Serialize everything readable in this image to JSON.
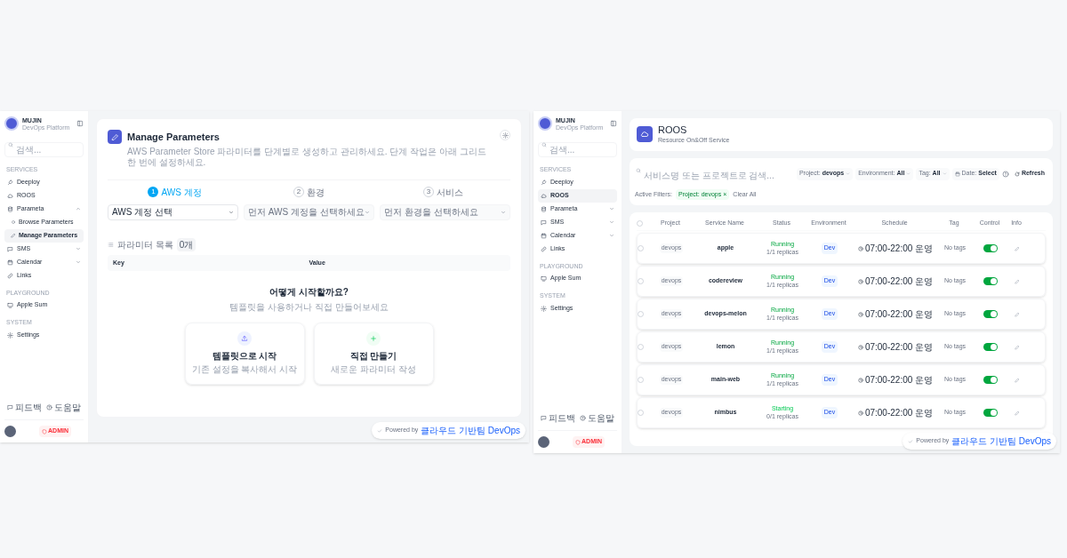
{
  "screens": [
    {
      "sidebar": {
        "brand": "MUJIN",
        "tagline": "DevOps Platform",
        "search": {
          "placeholder": "검색..."
        },
        "sections": [
          {
            "heading": "SERVICES",
            "items": [
              {
                "label": "Deeploy",
                "selected": false
              },
              {
                "label": "ROOS",
                "selected": false
              },
              {
                "label": "Parameta",
                "selected": false,
                "expanded": true,
                "children": [
                  {
                    "label": "Browse Parameters",
                    "selected": false
                  },
                  {
                    "label": "Manage Parameters",
                    "selected": true
                  }
                ]
              },
              {
                "label": "SMS",
                "selected": false,
                "expanded": false
              },
              {
                "label": "Calendar",
                "selected": false,
                "expanded": false
              },
              {
                "label": "Links",
                "selected": false
              }
            ]
          },
          {
            "heading": "PLAYGROUND",
            "items": [
              {
                "label": "Apple Sum",
                "selected": false
              }
            ]
          },
          {
            "heading": "SYSTEM",
            "items": [
              {
                "label": "Settings",
                "selected": false
              }
            ]
          }
        ],
        "footer_links": [
          "피드백",
          "도움말"
        ],
        "role": "ADMIN"
      },
      "page": {
        "kind": "parameters",
        "title": "Manage Parameters",
        "subtitle": "AWS Parameter Store 파라미터를 단계별로 생성하고 관리하세요. 단계 작업은 아래 그리드 한 번에 설정하세요.",
        "steps": [
          {
            "number": "1",
            "label": "AWS 계정",
            "selected": true
          },
          {
            "number": "2",
            "label": "환경",
            "selected": false
          },
          {
            "number": "3",
            "label": "서비스",
            "selected": false
          }
        ],
        "selects": [
          {
            "value": "AWS 계정 선택",
            "disabled": false
          },
          {
            "value": "먼저 AWS 계정을 선택하세요",
            "disabled": true
          },
          {
            "value": "먼저 환경을 선택하세요",
            "disabled": true
          }
        ],
        "list": {
          "title": "파라미터 목록",
          "count": "0개",
          "columns": [
            "Key",
            "Value"
          ]
        },
        "empty": {
          "title": "어떻게 시작할까요?",
          "subtitle": "템플릿을 사용하거나 직접 만들어보세요",
          "options": [
            {
              "title": "템플릿으로 시작",
              "subtitle": "기존 설정을 복사해서 시작"
            },
            {
              "title": "직접 만들기",
              "subtitle": "새로운 파라미터 작성"
            }
          ]
        },
        "footer": {
          "prefix": "Powered by",
          "team": "클라우드 기반팀 DevOps"
        }
      }
    },
    {
      "sidebar": {
        "brand": "MUJIN",
        "tagline": "DevOps Platform",
        "search": {
          "placeholder": "검색..."
        },
        "sections": [
          {
            "heading": "SERVICES",
            "items": [
              {
                "label": "Deeploy",
                "selected": false
              },
              {
                "label": "ROOS",
                "selected": true
              },
              {
                "label": "Parameta",
                "selected": false,
                "expanded": false
              },
              {
                "label": "SMS",
                "selected": false,
                "expanded": false
              },
              {
                "label": "Calendar",
                "selected": false,
                "expanded": false
              },
              {
                "label": "Links",
                "selected": false
              }
            ]
          },
          {
            "heading": "PLAYGROUND",
            "items": [
              {
                "label": "Apple Sum",
                "selected": false
              }
            ]
          },
          {
            "heading": "SYSTEM",
            "items": [
              {
                "label": "Settings",
                "selected": false
              }
            ]
          }
        ],
        "footer_links": [
          "피드백",
          "도움말"
        ],
        "role": "ADMIN"
      },
      "page": {
        "kind": "roos",
        "title": "ROOS",
        "subtitle": "Resource On&Off Service",
        "search": {
          "placeholder": "서비스명 또는 프로젝트로 검색..."
        },
        "filters": [
          {
            "kind": "dropdown",
            "label": "Project:",
            "value": "devops"
          },
          {
            "kind": "dropdown",
            "label": "Environment:",
            "value": "All"
          },
          {
            "kind": "dropdown",
            "label": "Tag:",
            "value": "All"
          },
          {
            "kind": "date",
            "label": "Date:",
            "value": "Select"
          }
        ],
        "refresh": "Refresh",
        "active_filters": {
          "label": "Active Filters:",
          "chips": [
            {
              "label": "Project: devops",
              "remove": "×"
            }
          ],
          "clear": "Clear All"
        },
        "select_all": {
          "checked": false
        },
        "columns": [
          "Project",
          "Service Name",
          "Status",
          "Environment",
          "Schedule",
          "Tag",
          "Control",
          "Info"
        ],
        "rows": [
          {
            "checked": false,
            "project": "devops",
            "service": "apple",
            "status": "Running",
            "replicas": "1/1 replicas",
            "environment": "Dev",
            "schedule": "07:00-22:00 운영",
            "tag": "No tags",
            "on": true
          },
          {
            "checked": false,
            "project": "devops",
            "service": "codereview",
            "status": "Running",
            "replicas": "1/1 replicas",
            "environment": "Dev",
            "schedule": "07:00-22:00 운영",
            "tag": "No tags",
            "on": true
          },
          {
            "checked": false,
            "project": "devops",
            "service": "devops-melon",
            "status": "Running",
            "replicas": "1/1 replicas",
            "environment": "Dev",
            "schedule": "07:00-22:00 운영",
            "tag": "No tags",
            "on": true
          },
          {
            "checked": false,
            "project": "devops",
            "service": "lemon",
            "status": "Running",
            "replicas": "1/1 replicas",
            "environment": "Dev",
            "schedule": "07:00-22:00 운영",
            "tag": "No tags",
            "on": true
          },
          {
            "checked": false,
            "project": "devops",
            "service": "main-web",
            "status": "Running",
            "replicas": "1/1 replicas",
            "environment": "Dev",
            "schedule": "07:00-22:00 운영",
            "tag": "No tags",
            "on": true
          },
          {
            "checked": false,
            "project": "devops",
            "service": "nimbus",
            "status": "Starting",
            "replicas": "0/1 replicas",
            "environment": "Dev",
            "schedule": "07:00-22:00 운영",
            "tag": "No tags",
            "on": true
          }
        ],
        "footer": {
          "prefix": "Powered by",
          "team": "클라우드 기반팀 DevOps"
        }
      }
    }
  ]
}
